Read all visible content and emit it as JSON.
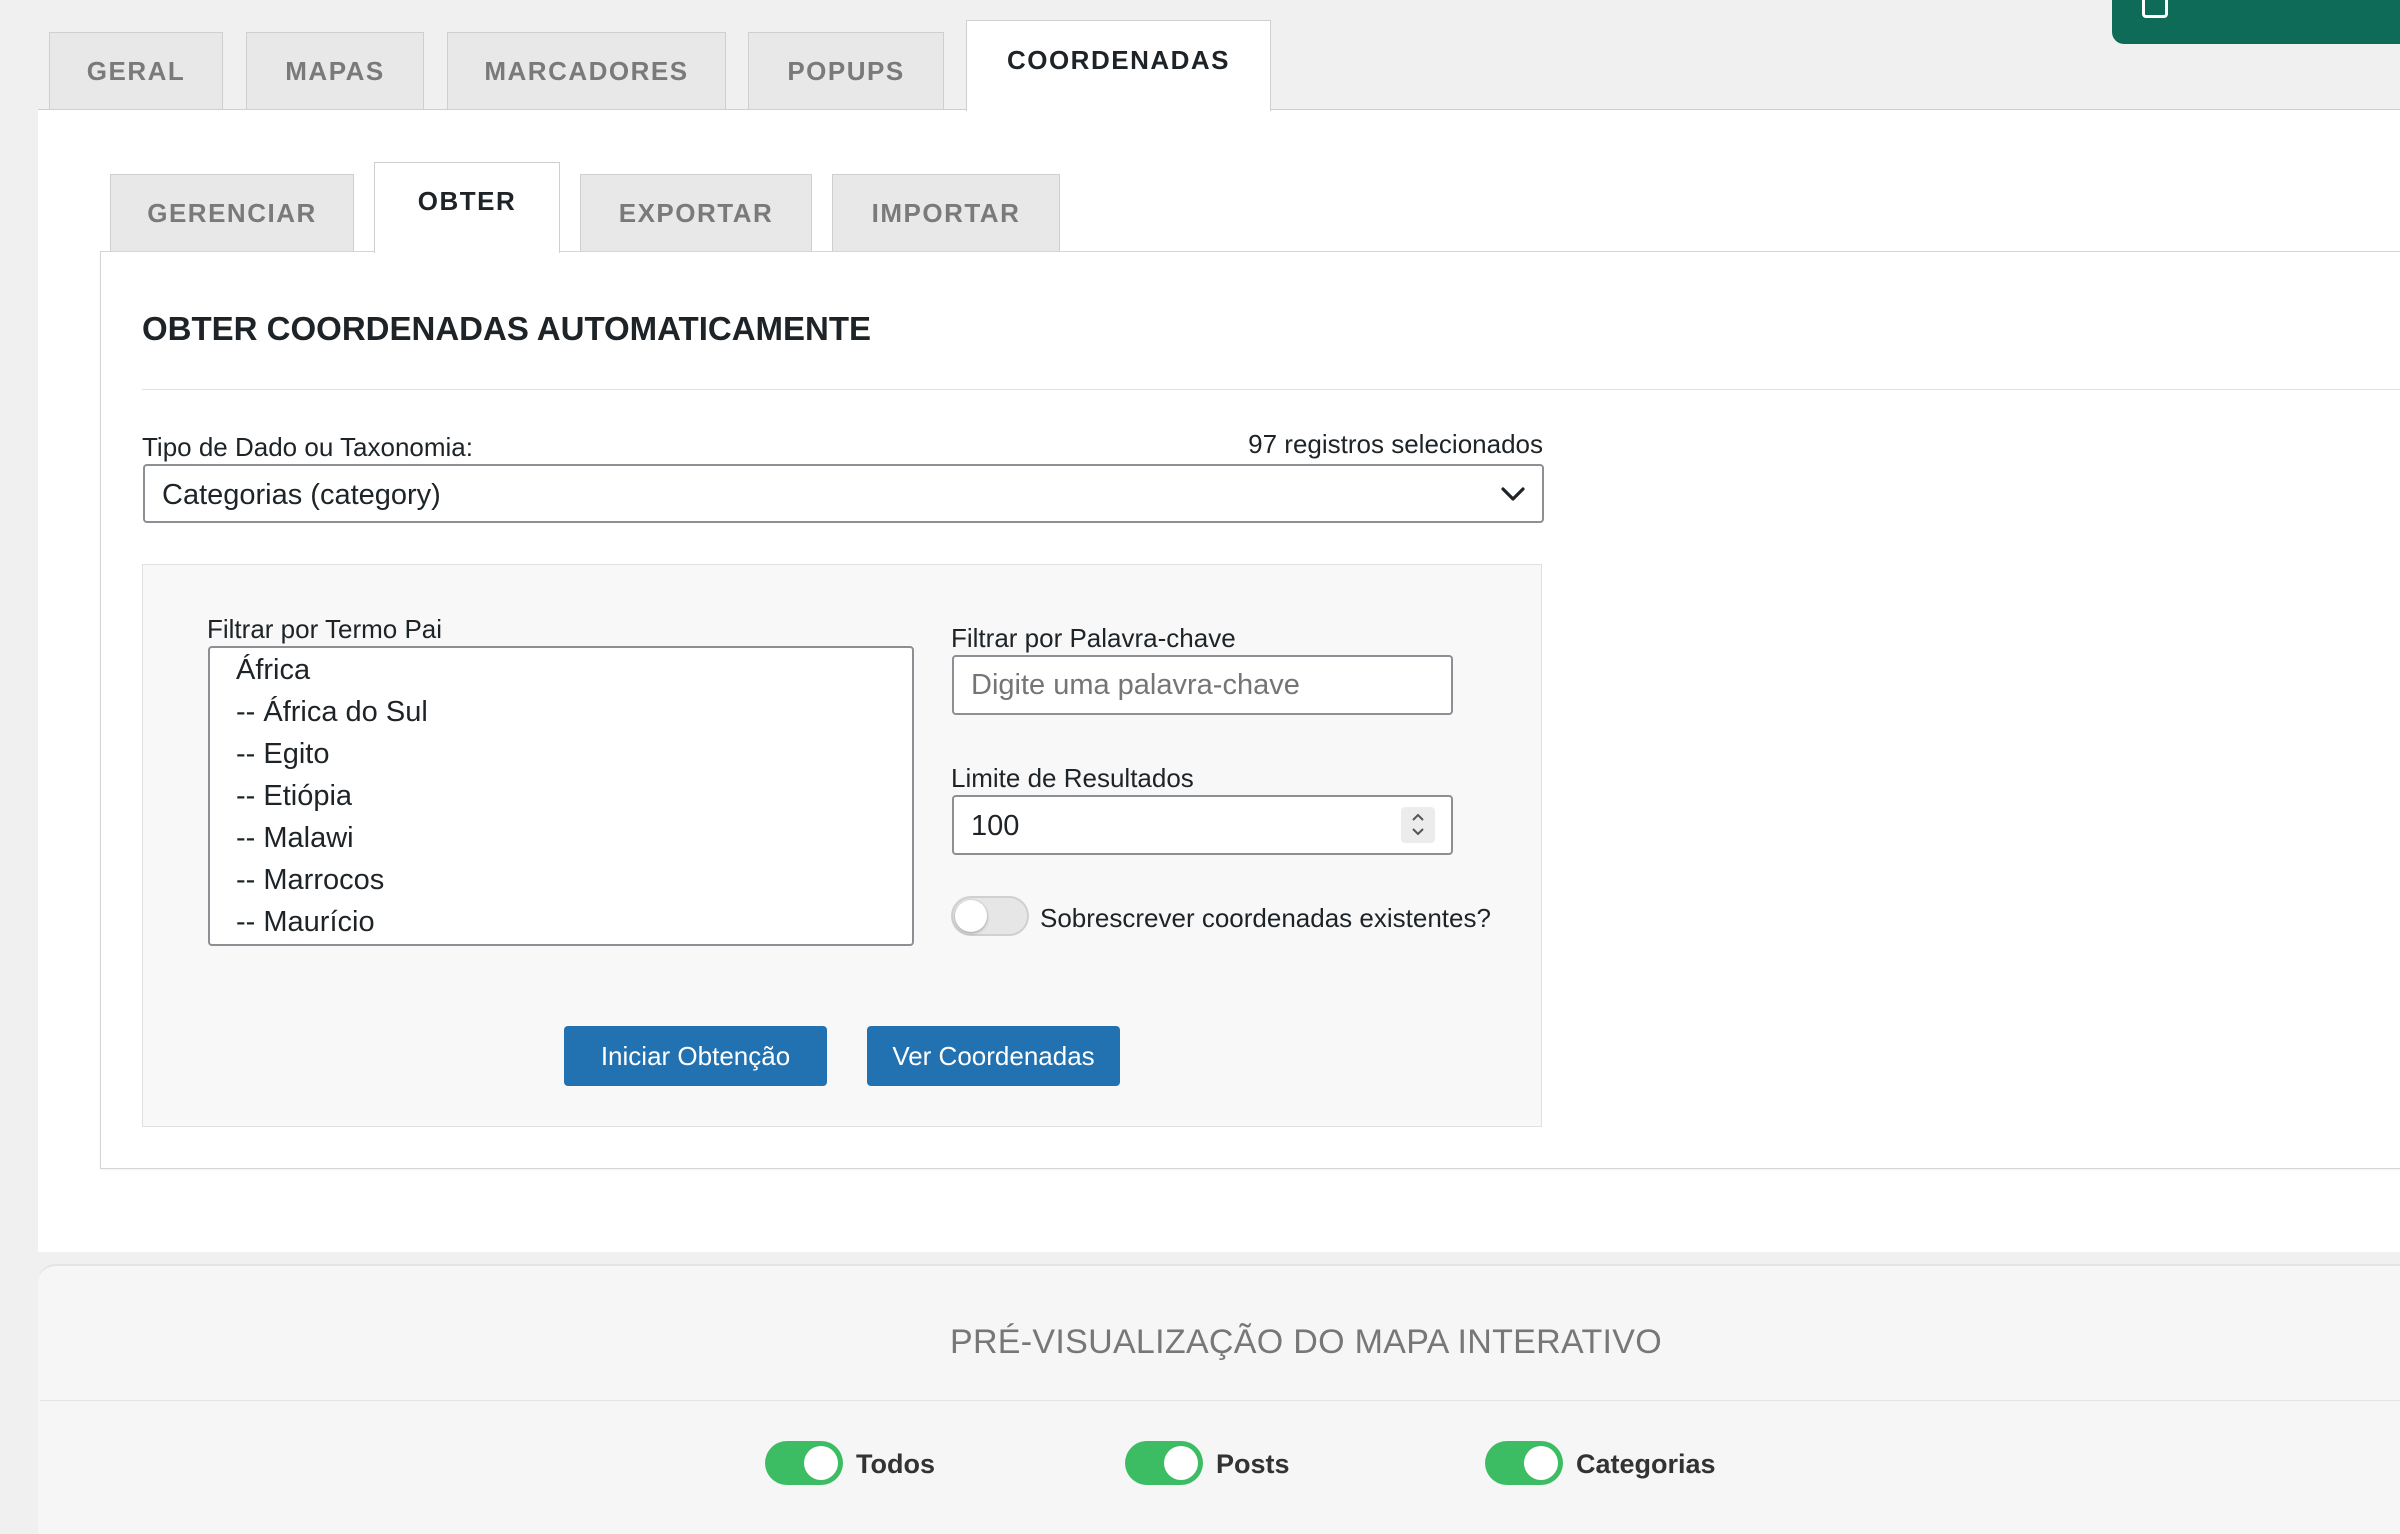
{
  "main_tabs": [
    {
      "label": "GERAL"
    },
    {
      "label": "MAPAS"
    },
    {
      "label": "MARCADORES"
    },
    {
      "label": "POPUPS"
    },
    {
      "label": "COORDENADAS",
      "active": true
    }
  ],
  "sub_tabs": [
    {
      "label": "GERENCIAR"
    },
    {
      "label": "OBTER",
      "active": true
    },
    {
      "label": "EXPORTAR"
    },
    {
      "label": "IMPORTAR"
    }
  ],
  "section": {
    "title": "OBTER COORDENADAS AUTOMATICAMENTE"
  },
  "type_field": {
    "label": "Tipo de Dado ou Taxonomia:",
    "count_text": "97 registros selecionados",
    "selected": "Categorias (category)",
    "icon": "chevron-down-icon"
  },
  "filter_parent": {
    "label": "Filtrar por Termo Pai",
    "options": [
      "África",
      "-- África do Sul",
      "-- Egito",
      "-- Etiópia",
      "-- Malawi",
      "-- Marrocos",
      "-- Maurício"
    ]
  },
  "filter_keyword": {
    "label": "Filtrar por Palavra-chave",
    "placeholder": "Digite uma palavra-chave",
    "value": ""
  },
  "limit": {
    "label": "Limite de Resultados",
    "value": "100"
  },
  "overwrite": {
    "label": "Sobrescrever coordenadas existentes?",
    "checked": false
  },
  "buttons": {
    "start": "Iniciar Obtenção",
    "view": "Ver Coordenadas"
  },
  "preview": {
    "title": "PRÉ-VISUALIZAÇÃO DO MAPA INTERATIVO",
    "legend": [
      {
        "label": "Todos",
        "on": true
      },
      {
        "label": "Posts",
        "on": true
      },
      {
        "label": "Categorias",
        "on": true
      }
    ]
  },
  "colors": {
    "primary_button": "#2271b1",
    "toggle_on": "#3dbd63",
    "top_right_button": "#0d6b58"
  }
}
